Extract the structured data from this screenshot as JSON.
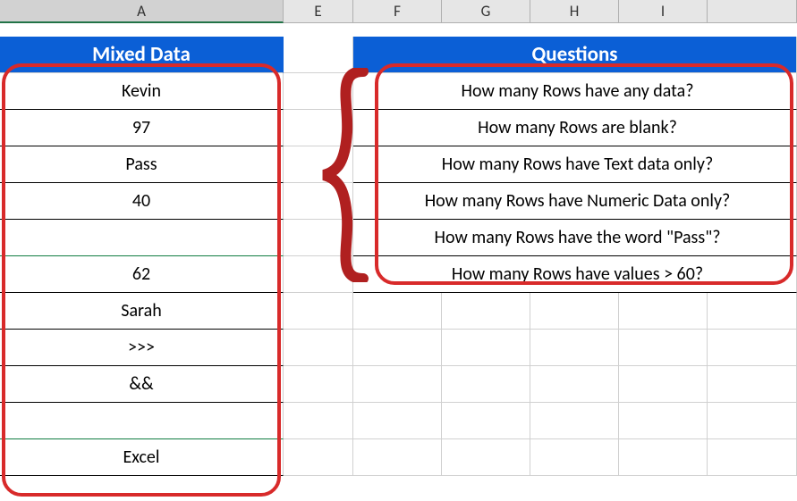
{
  "col_headers": [
    "A",
    "E",
    "F",
    "G",
    "H",
    "I"
  ],
  "headers": {
    "mixed_data": "Mixed Data",
    "questions": "Questions"
  },
  "mixed_data": {
    "rows": [
      "Kevin",
      "97",
      "Pass",
      "40",
      "",
      "62",
      "Sarah",
      ">>>",
      "&&",
      "",
      "Excel"
    ]
  },
  "questions": {
    "items": [
      "How many Rows have any data?",
      "How many Rows are blank?",
      "How many Rows have Text data only?",
      "How many Rows have Numeric Data only?",
      "How many Rows have the word \"Pass\"?",
      "How many Rows have values > 60?"
    ]
  }
}
